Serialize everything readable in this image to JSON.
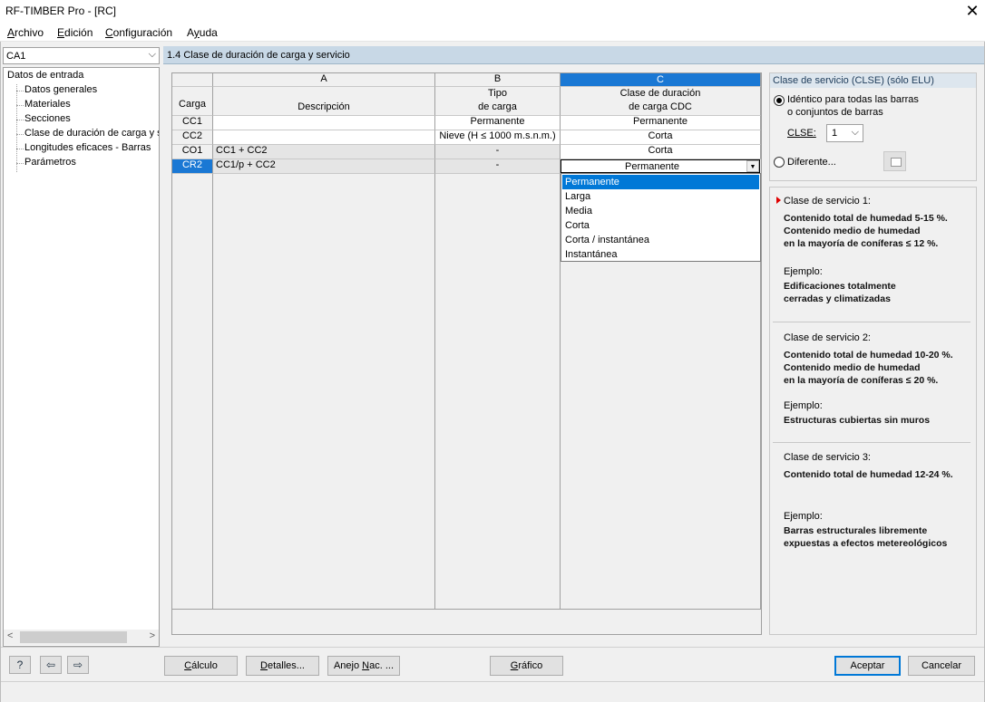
{
  "window": {
    "title": "RF-TIMBER Pro - [RC]",
    "close_glyph": "✕"
  },
  "menu": [
    {
      "pre": "",
      "acc": "A",
      "post": "rchivo"
    },
    {
      "pre": "",
      "acc": "E",
      "post": "dición"
    },
    {
      "pre": "",
      "acc": "C",
      "post": "onfiguración"
    },
    {
      "pre": "A",
      "acc": "y",
      "post": "uda"
    }
  ],
  "left": {
    "case_combo": "CA1",
    "tree": {
      "root": "Datos de entrada",
      "items": [
        "Datos generales",
        "Materiales",
        "Secciones",
        "Clase de duración de carga y se",
        "Longitudes eficaces - Barras",
        "Parámetros"
      ]
    }
  },
  "section_title": "1.4 Clase de duración de carga y servicio",
  "grid": {
    "col_letters": [
      "A",
      "B",
      "C"
    ],
    "row_header": "Carga",
    "col_a_header": "Descripción",
    "col_b_header": [
      "Tipo",
      "de carga"
    ],
    "col_c_header": [
      "Clase de duración",
      "de carga CDC"
    ],
    "rows": [
      {
        "id": "CC1",
        "desc": "",
        "type": "Permanente",
        "cdc": "Permanente"
      },
      {
        "id": "CC2",
        "desc": "",
        "type": "Nieve (H ≤ 1000 m.s.n.m.)",
        "cdc": "Corta"
      },
      {
        "id": "CO1",
        "desc": "CC1 + CC2",
        "type": "-",
        "cdc": "Corta"
      },
      {
        "id": "CR2",
        "desc": "CC1/p + CC2",
        "type": "-",
        "cdc": "Permanente"
      }
    ],
    "dropdown_options": [
      "Permanente",
      "Larga",
      "Media",
      "Corta",
      "Corta / instantánea",
      "Instantánea"
    ],
    "dropdown_selected": "Permanente"
  },
  "service_class": {
    "header": "Clase de servicio (CLSE) (sólo ELU)",
    "radio_identical": [
      "Idéntico para todas las barras",
      "o conjuntos de barras"
    ],
    "clse_label": "CLSE:",
    "clse_value": "1",
    "radio_different": "Diferente..."
  },
  "info": [
    {
      "title": "Clase de servicio 1:",
      "lines": [
        "Contenido total de humedad 5-15 %.",
        "Contenido medio de humedad",
        "en la mayoría de coníferas ≤ 12 %."
      ],
      "example_label": "Ejemplo:",
      "example": [
        "Edificaciones totalmente",
        "cerradas y climatizadas"
      ]
    },
    {
      "title": "Clase de servicio 2:",
      "lines": [
        "Contenido total de humedad 10-20 %.",
        "Contenido medio de humedad",
        "en la mayoría de coníferas ≤ 20 %."
      ],
      "example_label": "Ejemplo:",
      "example": [
        "Estructuras cubiertas sin muros"
      ]
    },
    {
      "title": "Clase de servicio 3:",
      "lines": [
        "Contenido total de humedad 12-24 %."
      ],
      "example_label": "Ejemplo:",
      "example": [
        "Barras estructurales libremente",
        "expuestas a efectos metereológicos"
      ]
    }
  ],
  "buttons": {
    "calculo": {
      "acc": "C",
      "post": "álculo"
    },
    "detalles": {
      "pre": "",
      "acc": "D",
      "post": "etalles..."
    },
    "anejo": {
      "pre": "Anejo ",
      "acc": "N",
      "post": "ac. ..."
    },
    "grafico": {
      "acc": "G",
      "post": "ráfico"
    },
    "aceptar": "Aceptar",
    "cancelar": "Cancelar"
  },
  "icons": {
    "help": "?",
    "prev": "⇦",
    "next": "⇨",
    "scroll_left": "<",
    "scroll_right": ">",
    "combo_chevron": "⌵",
    "dropdown_arrow": "▼"
  }
}
